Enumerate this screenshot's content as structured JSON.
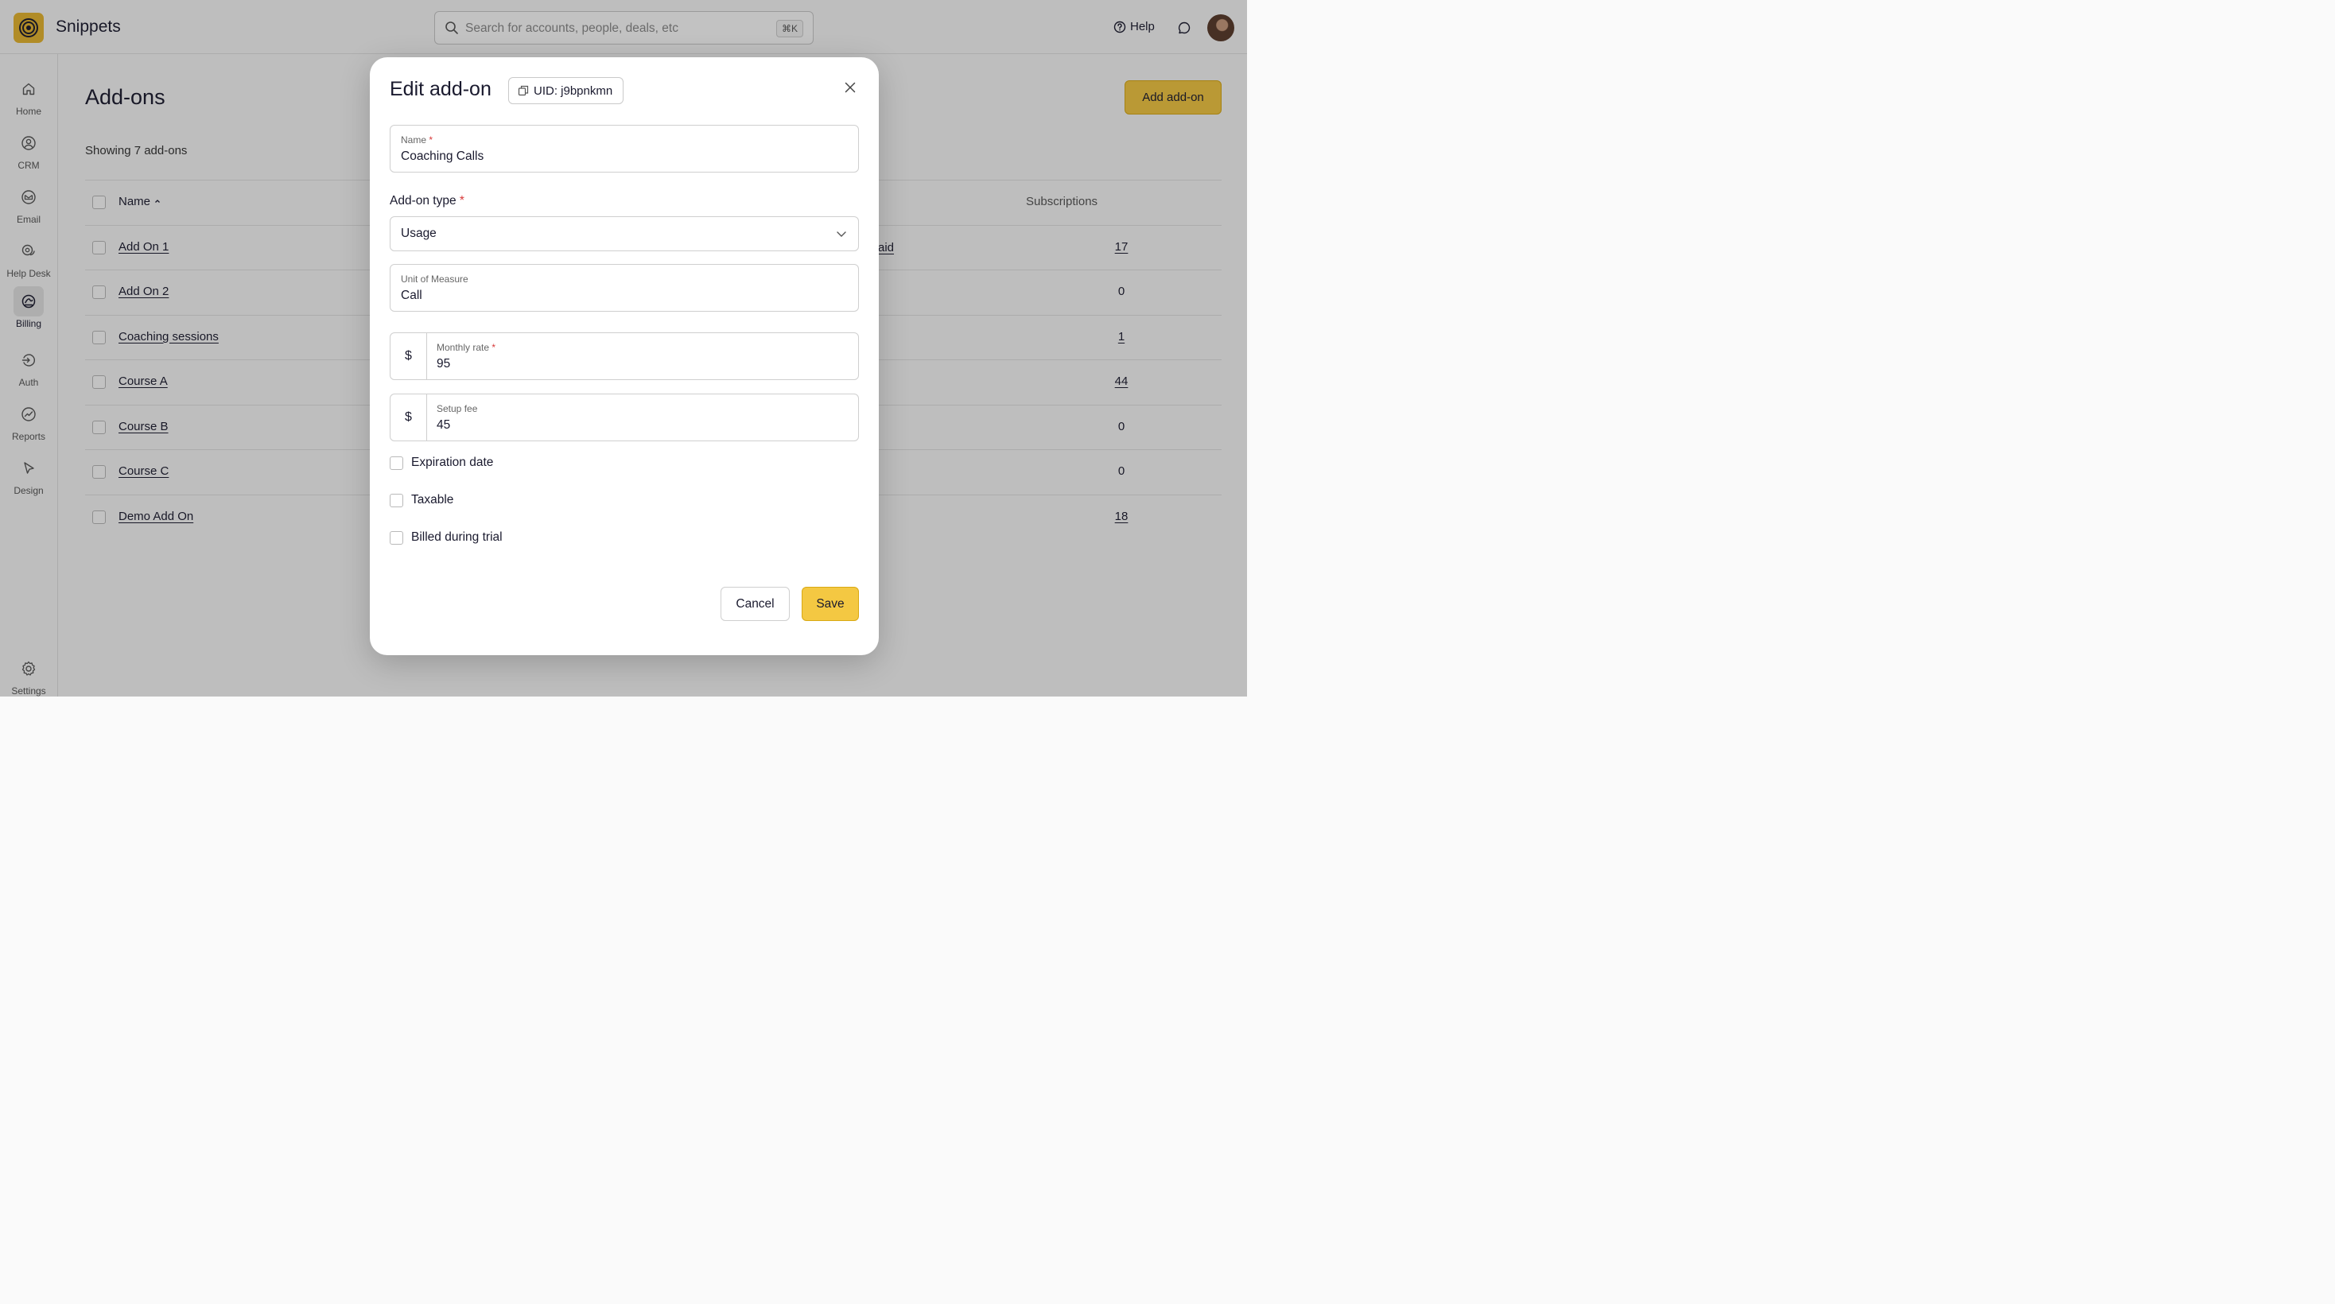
{
  "app": {
    "name": "Snippets"
  },
  "search": {
    "placeholder": "Search for accounts, people, deals, etc",
    "shortcut": "⌘K"
  },
  "header": {
    "help_label": "Help"
  },
  "sidebar": {
    "items": [
      {
        "label": "Home",
        "icon": "home-icon"
      },
      {
        "label": "CRM",
        "icon": "user-circle-icon"
      },
      {
        "label": "Email",
        "icon": "mail-icon"
      },
      {
        "label": "Help Desk",
        "icon": "chat-bubbles-icon"
      },
      {
        "label": "Billing",
        "icon": "billing-icon",
        "active": true
      },
      {
        "label": "Auth",
        "icon": "auth-icon"
      },
      {
        "label": "Reports",
        "icon": "reports-icon"
      },
      {
        "label": "Design",
        "icon": "cursor-icon"
      },
      {
        "label": "Settings",
        "icon": "gear-icon"
      }
    ]
  },
  "main": {
    "title": "Add-ons",
    "add_button": "Add add-on",
    "showing": "Showing 7 add-ons",
    "columns": {
      "name": "Name",
      "subscriptions": "Subscriptions"
    },
    "rows": [
      {
        "name": "Add On 1",
        "subscriptions": "17"
      },
      {
        "name": "Add On 2",
        "subscriptions": "0"
      },
      {
        "name": "Coaching sessions",
        "subscriptions": "1"
      },
      {
        "name": "Course A",
        "subscriptions": "44"
      },
      {
        "name": "Course B",
        "subscriptions": "0"
      },
      {
        "name": "Course C",
        "subscriptions": "0"
      },
      {
        "name": "Demo Add On",
        "subscriptions": "18"
      }
    ],
    "partial_text": "aid"
  },
  "modal": {
    "title": "Edit add-on",
    "uid": "UID: j9bpnkmn",
    "name_label": "Name",
    "name_value": "Coaching Calls",
    "type_label": "Add-on type",
    "type_value": "Usage",
    "unit_label": "Unit of Measure",
    "unit_value": "Call",
    "currency_symbol": "$",
    "monthly_label": "Monthly rate",
    "monthly_value": "95",
    "setup_label": "Setup fee",
    "setup_value": "45",
    "required_mark": "*",
    "checkboxes": [
      {
        "label": "Expiration date",
        "checked": false
      },
      {
        "label": "Taxable",
        "checked": false
      },
      {
        "label": "Billed during trial",
        "checked": false
      }
    ],
    "cancel_label": "Cancel",
    "save_label": "Save"
  },
  "colors": {
    "accent": "#f4c842",
    "logo": "#e8b72e",
    "required": "#d83a3a"
  }
}
